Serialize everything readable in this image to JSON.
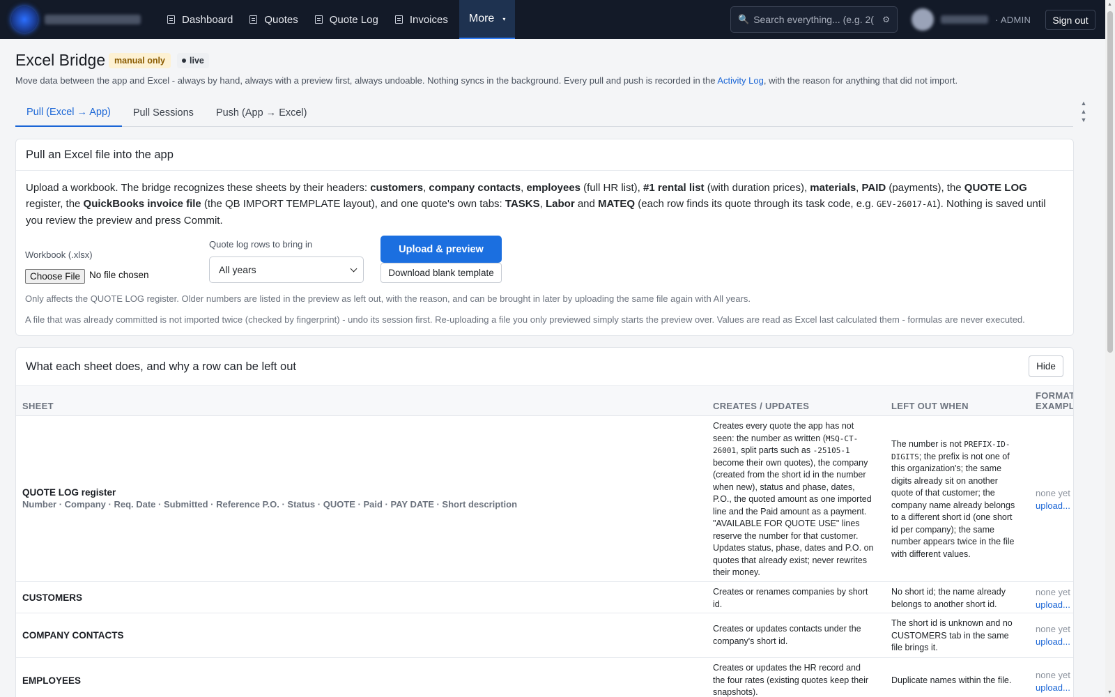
{
  "nav": {
    "items": [
      {
        "label": "Dashboard"
      },
      {
        "label": "Quotes"
      },
      {
        "label": "Quote Log"
      },
      {
        "label": "Invoices"
      }
    ],
    "more_label": "More",
    "more_caret": "▾",
    "search_placeholder": "Search everything... (e.g. 2(",
    "role": "· ADMIN",
    "sign_out": "Sign out"
  },
  "header": {
    "title": "Excel Bridge",
    "badge_manual": "manual only",
    "badge_live": "live",
    "intro_before": "Move data between the app and Excel - always by hand, always with a preview first, always undoable. Nothing syncs in the background. Every pull and push is recorded in the ",
    "intro_link": "Activity Log",
    "intro_after": ", with the reason for anything that did not import."
  },
  "tabs": [
    {
      "label": "Pull (Excel → App)",
      "active": true
    },
    {
      "label": "Pull Sessions"
    },
    {
      "label": "Push (App → Excel)"
    }
  ],
  "pull_card": {
    "title": "Pull an Excel file into the app",
    "desc": {
      "t1": "Upload a workbook. The bridge recognizes these sheets by their headers: ",
      "b1": "customers",
      "t2": ", ",
      "b2": "company contacts",
      "t3": ", ",
      "b3": "employees",
      "t4": " (full HR list), ",
      "b4": "#1 rental list",
      "t5": " (with duration prices), ",
      "b5": "materials",
      "t6": ", ",
      "b6": "PAID",
      "t7": " (payments), the ",
      "b7": "QUOTE LOG",
      "t8": " register, the ",
      "b8": "QuickBooks invoice file",
      "t9": " (the QB IMPORT TEMPLATE layout), and one quote's own tabs: ",
      "b9": "TASKS",
      "t10": ", ",
      "b10": "Labor",
      "t11": " and ",
      "b11": "MATEQ",
      "t12": " (each row finds its quote through its task code, e.g. ",
      "code": "GEV-26017-A1",
      "t13": "). Nothing is saved until you review the preview and press Commit."
    },
    "workbook_label": "Workbook (.xlsx)",
    "choose_file": "Choose File",
    "no_file": "No file chosen",
    "rows_label": "Quote log rows to bring in",
    "rows_value": "All years",
    "upload_btn": "Upload & preview",
    "template_btn": "Download blank template",
    "hint1": "Only affects the QUOTE LOG register. Older numbers are listed in the preview as left out, with the reason, and can be brought in later by uploading the same file again with All years.",
    "hint2": "A file that was already committed is not imported twice (checked by fingerprint) - undo its session first. Re-uploading a file you only previewed simply starts the preview over. Values are read as Excel last calculated them - formulas are never executed."
  },
  "sheets_card": {
    "title": "What each sheet does, and why a row can be left out",
    "hide": "Hide",
    "columns": {
      "sheet": "SHEET",
      "creates": "CREATES / UPDATES",
      "left_out": "LEFT OUT WHEN",
      "format_1": "FORMAT",
      "format_2": "EXAMPLE"
    },
    "rows": [
      {
        "name": "QUOTE LOG register",
        "cols": "Number · Company · Req. Date · Submitted · Reference P.O. · Status · QUOTE · Paid · PAY DATE · Short description",
        "creates_a": "Creates every quote the app has not seen: the number as written (",
        "creates_code1": "MSQ-CT-26001",
        "creates_b": ", split parts such as ",
        "creates_code2": "-25105-1",
        "creates_c": " become their own quotes), the company (created from the short id in the number when new), status and phase, dates, P.O., the quoted amount as one imported line and the Paid amount as a payment. \"AVAILABLE FOR QUOTE USE\" lines reserve the number for that customer. Updates status, phase, dates and P.O. on quotes that already exist; never rewrites their money.",
        "left_a": "The number is not ",
        "left_code": "PREFIX-ID-DIGITS",
        "left_b": "; the prefix is not one of this organization's; the same digits already sit on another quote of that customer; the company name already belongs to a different short id (one short id per company); the same number appears twice in the file with different values.",
        "none": "none yet",
        "upload": "upload..."
      },
      {
        "name": "CUSTOMERS",
        "creates": "Creates or renames companies by short id.",
        "left_out": "No short id; the name already belongs to another short id.",
        "none": "none yet",
        "upload": "upload..."
      },
      {
        "name": "COMPANY CONTACTS",
        "creates": "Creates or updates contacts under the company's short id.",
        "left_out": "The short id is unknown and no CUSTOMERS tab in the same file brings it.",
        "none": "none yet",
        "upload": "upload..."
      },
      {
        "name": "EMPLOYEES",
        "creates": "Creates or updates the HR record and the four rates (existing quotes keep their snapshots).",
        "left_out": "Duplicate names within the file.",
        "none": "none yet",
        "upload": "upload..."
      }
    ]
  }
}
